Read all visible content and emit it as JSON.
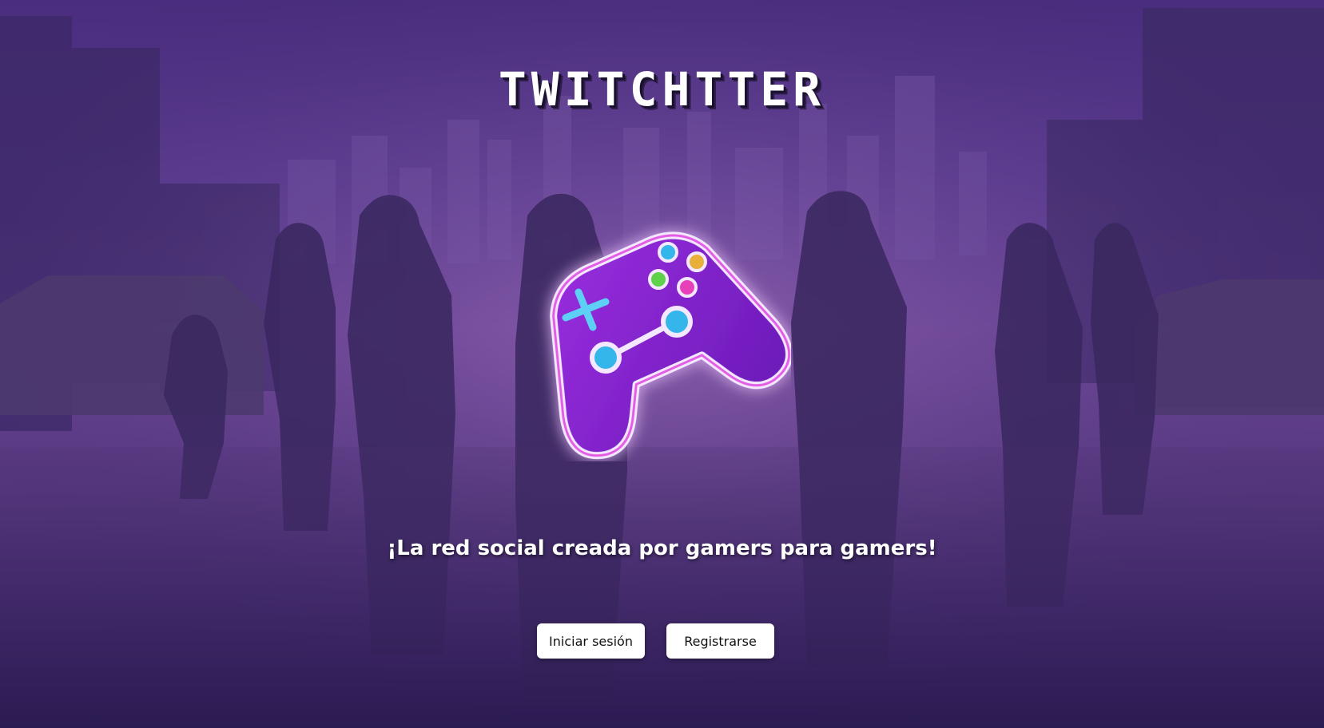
{
  "app": {
    "title": "TWITCHTTER",
    "tagline": "¡La red social creada por gamers para gamers!"
  },
  "actions": {
    "login_label": "Iniciar sesión",
    "register_label": "Registrarse"
  },
  "colors": {
    "background_tint": "#5a3a8f",
    "button_bg": "#ffffff",
    "controller_fill": "#8a1fd6",
    "controller_glow": "#e030d8",
    "button_blue": "#35b6ea",
    "button_green": "#5fd14a",
    "button_yellow": "#e8b03a",
    "button_pink": "#e840b8"
  },
  "icons": {
    "logo": "gamepad-neon-icon"
  }
}
